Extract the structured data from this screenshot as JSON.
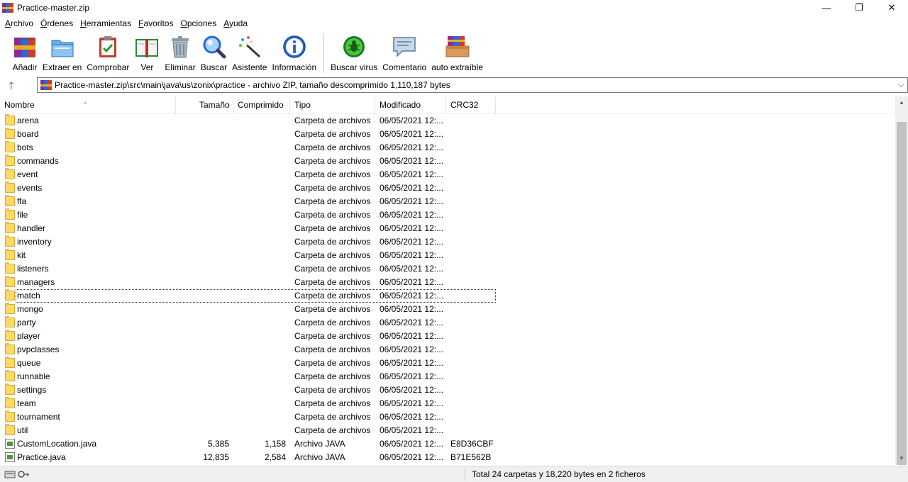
{
  "window": {
    "title": "Practice-master.zip",
    "minimize_glyph": "—",
    "maximize_glyph": "❐",
    "close_glyph": "✕"
  },
  "menu": [
    {
      "label": "Archivo",
      "u": "A",
      "rest": "rchivo"
    },
    {
      "label": "Órdenes",
      "u": "Ó",
      "rest": "rdenes"
    },
    {
      "label": "Herramientas",
      "u": "H",
      "rest": "erramientas"
    },
    {
      "label": "Favoritos",
      "u": "F",
      "rest": "avoritos"
    },
    {
      "label": "Opciones",
      "u": "O",
      "rest": "pciones"
    },
    {
      "label": "Ayuda",
      "u": "A",
      "rest": "yuda"
    }
  ],
  "toolbar": [
    {
      "label": "Añadir",
      "icon": "add-archive-icon"
    },
    {
      "label": "Extraer en",
      "icon": "extract-folder-icon"
    },
    {
      "label": "Comprobar",
      "icon": "test-clipboard-icon"
    },
    {
      "label": "Ver",
      "icon": "view-book-icon"
    },
    {
      "label": "Eliminar",
      "icon": "trash-can-icon"
    },
    {
      "label": "Buscar",
      "icon": "magnifier-icon"
    },
    {
      "label": "Asistente",
      "icon": "magic-wand-icon"
    },
    {
      "label": "Información",
      "icon": "info-icon"
    },
    {
      "label": "Buscar virus",
      "icon": "virus-scan-icon"
    },
    {
      "label": "Comentario",
      "icon": "comment-icon"
    },
    {
      "label": "auto extraíble",
      "icon": "sfx-box-icon"
    }
  ],
  "address": {
    "up_glyph": "🡑",
    "path": "Practice-master.zip\\src\\main\\java\\us\\zonix\\practice - archivo ZIP, tamaño descomprimido 1,110,187 bytes",
    "dropdown_glyph": "⌵"
  },
  "columns": {
    "name": "Nombre",
    "size": "Tamaño",
    "compressed": "Comprimido",
    "type": "Tipo",
    "modified": "Modificado",
    "crc": "CRC32",
    "sort_glyph": "^"
  },
  "rows": [
    {
      "name": "arena",
      "kind": "folder",
      "size": "",
      "compressed": "",
      "type": "Carpeta de archivos",
      "modified": "06/05/2021 12:...",
      "crc": ""
    },
    {
      "name": "board",
      "kind": "folder",
      "size": "",
      "compressed": "",
      "type": "Carpeta de archivos",
      "modified": "06/05/2021 12:...",
      "crc": ""
    },
    {
      "name": "bots",
      "kind": "folder",
      "size": "",
      "compressed": "",
      "type": "Carpeta de archivos",
      "modified": "06/05/2021 12:...",
      "crc": ""
    },
    {
      "name": "commands",
      "kind": "folder",
      "size": "",
      "compressed": "",
      "type": "Carpeta de archivos",
      "modified": "06/05/2021 12:...",
      "crc": ""
    },
    {
      "name": "event",
      "kind": "folder",
      "size": "",
      "compressed": "",
      "type": "Carpeta de archivos",
      "modified": "06/05/2021 12:...",
      "crc": ""
    },
    {
      "name": "events",
      "kind": "folder",
      "size": "",
      "compressed": "",
      "type": "Carpeta de archivos",
      "modified": "06/05/2021 12:...",
      "crc": ""
    },
    {
      "name": "ffa",
      "kind": "folder",
      "size": "",
      "compressed": "",
      "type": "Carpeta de archivos",
      "modified": "06/05/2021 12:...",
      "crc": ""
    },
    {
      "name": "file",
      "kind": "folder",
      "size": "",
      "compressed": "",
      "type": "Carpeta de archivos",
      "modified": "06/05/2021 12:...",
      "crc": ""
    },
    {
      "name": "handler",
      "kind": "folder",
      "size": "",
      "compressed": "",
      "type": "Carpeta de archivos",
      "modified": "06/05/2021 12:...",
      "crc": ""
    },
    {
      "name": "inventory",
      "kind": "folder",
      "size": "",
      "compressed": "",
      "type": "Carpeta de archivos",
      "modified": "06/05/2021 12:...",
      "crc": ""
    },
    {
      "name": "kit",
      "kind": "folder",
      "size": "",
      "compressed": "",
      "type": "Carpeta de archivos",
      "modified": "06/05/2021 12:...",
      "crc": ""
    },
    {
      "name": "listeners",
      "kind": "folder",
      "size": "",
      "compressed": "",
      "type": "Carpeta de archivos",
      "modified": "06/05/2021 12:...",
      "crc": ""
    },
    {
      "name": "managers",
      "kind": "folder",
      "size": "",
      "compressed": "",
      "type": "Carpeta de archivos",
      "modified": "06/05/2021 12:...",
      "crc": ""
    },
    {
      "name": "match",
      "kind": "folder",
      "focused": true,
      "size": "",
      "compressed": "",
      "type": "Carpeta de archivos",
      "modified": "06/05/2021 12:...",
      "crc": ""
    },
    {
      "name": "mongo",
      "kind": "folder",
      "size": "",
      "compressed": "",
      "type": "Carpeta de archivos",
      "modified": "06/05/2021 12:...",
      "crc": ""
    },
    {
      "name": "party",
      "kind": "folder",
      "size": "",
      "compressed": "",
      "type": "Carpeta de archivos",
      "modified": "06/05/2021 12:...",
      "crc": ""
    },
    {
      "name": "player",
      "kind": "folder",
      "size": "",
      "compressed": "",
      "type": "Carpeta de archivos",
      "modified": "06/05/2021 12:...",
      "crc": ""
    },
    {
      "name": "pvpclasses",
      "kind": "folder",
      "size": "",
      "compressed": "",
      "type": "Carpeta de archivos",
      "modified": "06/05/2021 12:...",
      "crc": ""
    },
    {
      "name": "queue",
      "kind": "folder",
      "size": "",
      "compressed": "",
      "type": "Carpeta de archivos",
      "modified": "06/05/2021 12:...",
      "crc": ""
    },
    {
      "name": "runnable",
      "kind": "folder",
      "size": "",
      "compressed": "",
      "type": "Carpeta de archivos",
      "modified": "06/05/2021 12:...",
      "crc": ""
    },
    {
      "name": "settings",
      "kind": "folder",
      "size": "",
      "compressed": "",
      "type": "Carpeta de archivos",
      "modified": "06/05/2021 12:...",
      "crc": ""
    },
    {
      "name": "team",
      "kind": "folder",
      "size": "",
      "compressed": "",
      "type": "Carpeta de archivos",
      "modified": "06/05/2021 12:...",
      "crc": ""
    },
    {
      "name": "tournament",
      "kind": "folder",
      "size": "",
      "compressed": "",
      "type": "Carpeta de archivos",
      "modified": "06/05/2021 12:...",
      "crc": ""
    },
    {
      "name": "util",
      "kind": "folder",
      "size": "",
      "compressed": "",
      "type": "Carpeta de archivos",
      "modified": "06/05/2021 12:...",
      "crc": ""
    },
    {
      "name": "CustomLocation.java",
      "kind": "java",
      "size": "5,385",
      "compressed": "1,158",
      "type": "Archivo JAVA",
      "modified": "06/05/2021 12:...",
      "crc": "E8D36CBF"
    },
    {
      "name": "Practice.java",
      "kind": "java",
      "size": "12,835",
      "compressed": "2,584",
      "type": "Archivo JAVA",
      "modified": "06/05/2021 12:...",
      "crc": "B71E562B"
    }
  ],
  "scrollbar": {
    "up_glyph": "▲",
    "down_glyph": "▼"
  },
  "status": {
    "text": "Total 24 carpetas y 18,220 bytes en 2 ficheros"
  }
}
